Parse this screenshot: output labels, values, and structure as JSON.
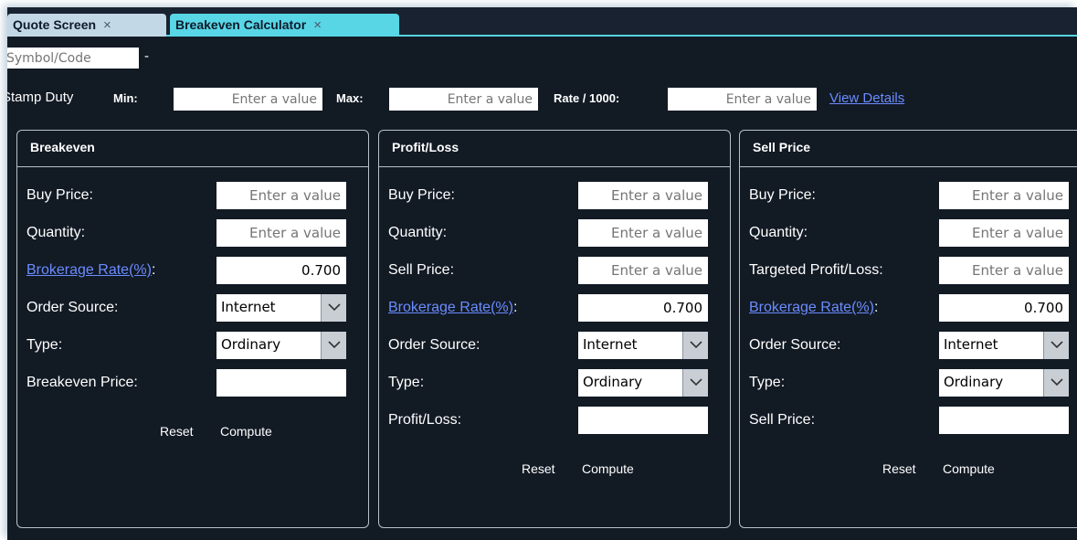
{
  "tabs": [
    {
      "label": "Quote Screen",
      "close": "×"
    },
    {
      "label": "Breakeven Calculator",
      "close": "×"
    }
  ],
  "symbol": {
    "placeholder": "Symbol/Code",
    "dash": "-"
  },
  "stamp_duty": {
    "label": "Stamp Duty",
    "min_label": "Min:",
    "max_label": "Max:",
    "rate_label": "Rate / 1000:",
    "placeholder": "Enter a value",
    "view_details": "View Details"
  },
  "panels": {
    "breakeven": {
      "title": "Breakeven",
      "buy_price_label": "Buy Price:",
      "quantity_label": "Quantity:",
      "brokerage_label": "Brokerage Rate(%)",
      "brokerage_value": "0.700",
      "order_source_label": "Order Source:",
      "order_source_value": "Internet",
      "type_label": "Type:",
      "type_value": "Ordinary",
      "result_label": "Breakeven Price:",
      "reset": "Reset",
      "compute": "Compute"
    },
    "profit_loss": {
      "title": "Profit/Loss",
      "buy_price_label": "Buy Price:",
      "quantity_label": "Quantity:",
      "sell_price_label": "Sell Price:",
      "brokerage_label": "Brokerage Rate(%)",
      "brokerage_value": "0.700",
      "order_source_label": "Order Source:",
      "order_source_value": "Internet",
      "type_label": "Type:",
      "type_value": "Ordinary",
      "result_label": "Profit/Loss:",
      "reset": "Reset",
      "compute": "Compute"
    },
    "sell_price": {
      "title": "Sell Price",
      "buy_price_label": "Buy Price:",
      "quantity_label": "Quantity:",
      "target_label": "Targeted Profit/Loss:",
      "brokerage_label": "Brokerage Rate(%)",
      "brokerage_value": "0.700",
      "order_source_label": "Order Source:",
      "order_source_value": "Internet",
      "type_label": "Type:",
      "type_value": "Ordinary",
      "result_label": "Sell Price:",
      "reset": "Reset",
      "compute": "Compute"
    }
  },
  "placeholder": "Enter a value",
  "colon": ":"
}
